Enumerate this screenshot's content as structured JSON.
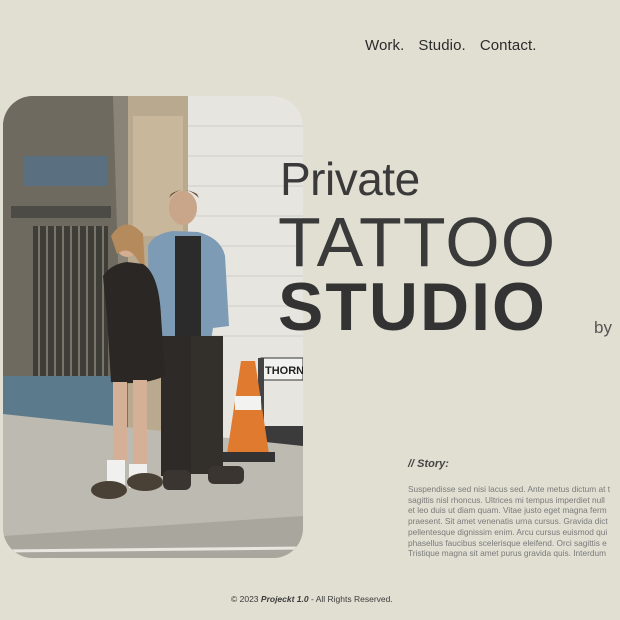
{
  "nav": {
    "links": [
      "Work.",
      "Studio.",
      "Contact."
    ]
  },
  "hero": {
    "line1": "Private",
    "line2": "TATTOO",
    "line3": "STUDIO",
    "byline": "by"
  },
  "photo": {
    "icon": "photo-couple-street-image",
    "sign_text": "THORN"
  },
  "story": {
    "heading": "// Story:",
    "lines": [
      "Suspendisse sed nisi lacus sed. Ante metus dictum at t",
      "sagittis nisl rhoncus. Ultrices mi tempus imperdiet null",
      "et leo duis ut diam quam. Vitae justo eget magna ferm",
      "praesent. Sit amet venenatis urna cursus. Gravida dict",
      "pellentesque dignissim enim. Arcu cursus euismod qui",
      "phasellus faucibus scelerisque eleifend. Orci sagittis e",
      "Tristique magna sit amet purus gravida quis. Interdum"
    ]
  },
  "footer": {
    "prefix": "© 2023 ",
    "brand": "Projeckt 1.0",
    "suffix": " - All Rights Reserved."
  },
  "colors": {
    "background": "#e1dfd2",
    "text": "#2f2f2f"
  }
}
